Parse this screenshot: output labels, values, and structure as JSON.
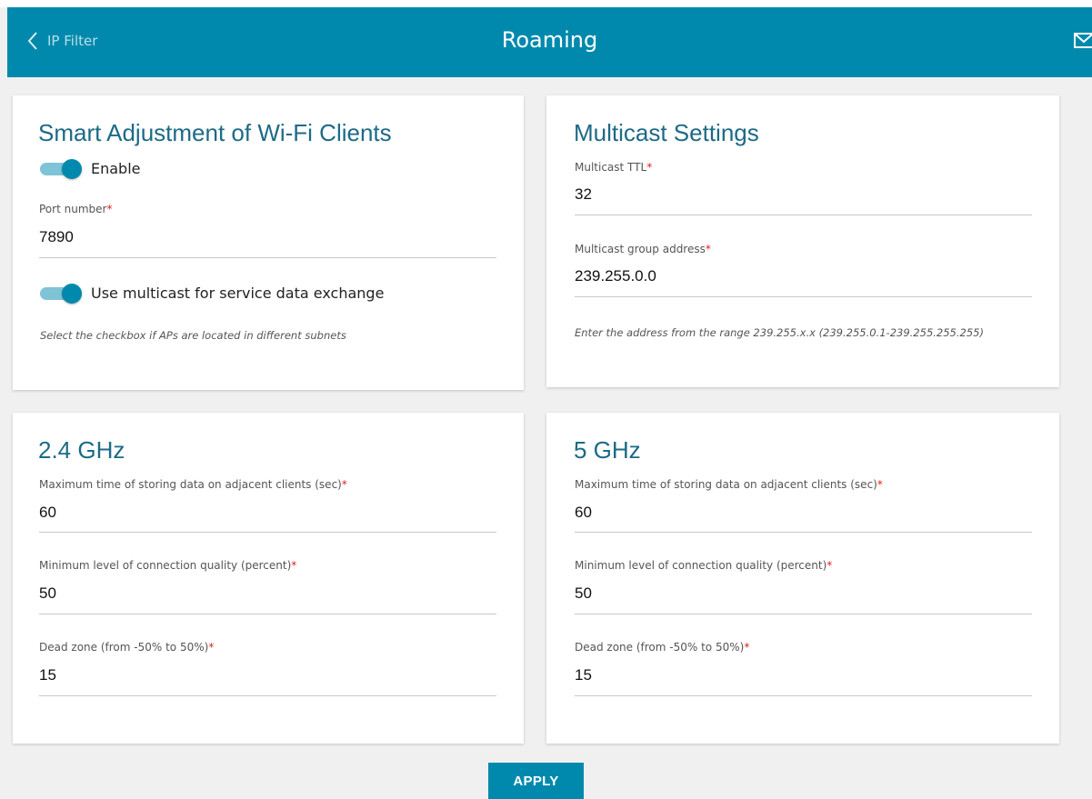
{
  "header": {
    "back_label": "IP Filter",
    "title": "Roaming"
  },
  "smart": {
    "title": "Smart Adjustment of Wi-Fi Clients",
    "enable_label": "Enable",
    "enable_on": true,
    "port_label": "Port number",
    "port_value": "7890",
    "multicast_label": "Use multicast for service data exchange",
    "multicast_on": true,
    "hint": "Select the checkbox if APs are located in different subnets"
  },
  "multicast": {
    "title": "Multicast Settings",
    "ttl_label": "Multicast TTL",
    "ttl_value": "32",
    "group_label": "Multicast group address",
    "group_value": "239.255.0.0",
    "hint": "Enter the address from the range 239.255.x.x (239.255.0.1-239.255.255.255)"
  },
  "band24": {
    "title": "2.4 GHz",
    "max_time_label": "Maximum time of storing data on adjacent clients (sec)",
    "max_time_value": "60",
    "min_quality_label": "Minimum level of connection quality (percent)",
    "min_quality_value": "50",
    "dead_zone_label": "Dead zone (from -50% to 50%)",
    "dead_zone_value": "15"
  },
  "band5": {
    "title": "5 GHz",
    "max_time_label": "Maximum time of storing data on adjacent clients (sec)",
    "max_time_value": "60",
    "min_quality_label": "Minimum level of connection quality (percent)",
    "min_quality_value": "50",
    "dead_zone_label": "Dead zone (from -50% to 50%)",
    "dead_zone_value": "15"
  },
  "required_mark": "*",
  "apply_label": "APPLY",
  "colors": {
    "accent": "#0089ad",
    "title": "#1d6a86",
    "required": "#e0201b",
    "background": "#f0f0f0"
  },
  "icons": {
    "back": "chevron-left-icon",
    "mail": "mail-icon"
  }
}
